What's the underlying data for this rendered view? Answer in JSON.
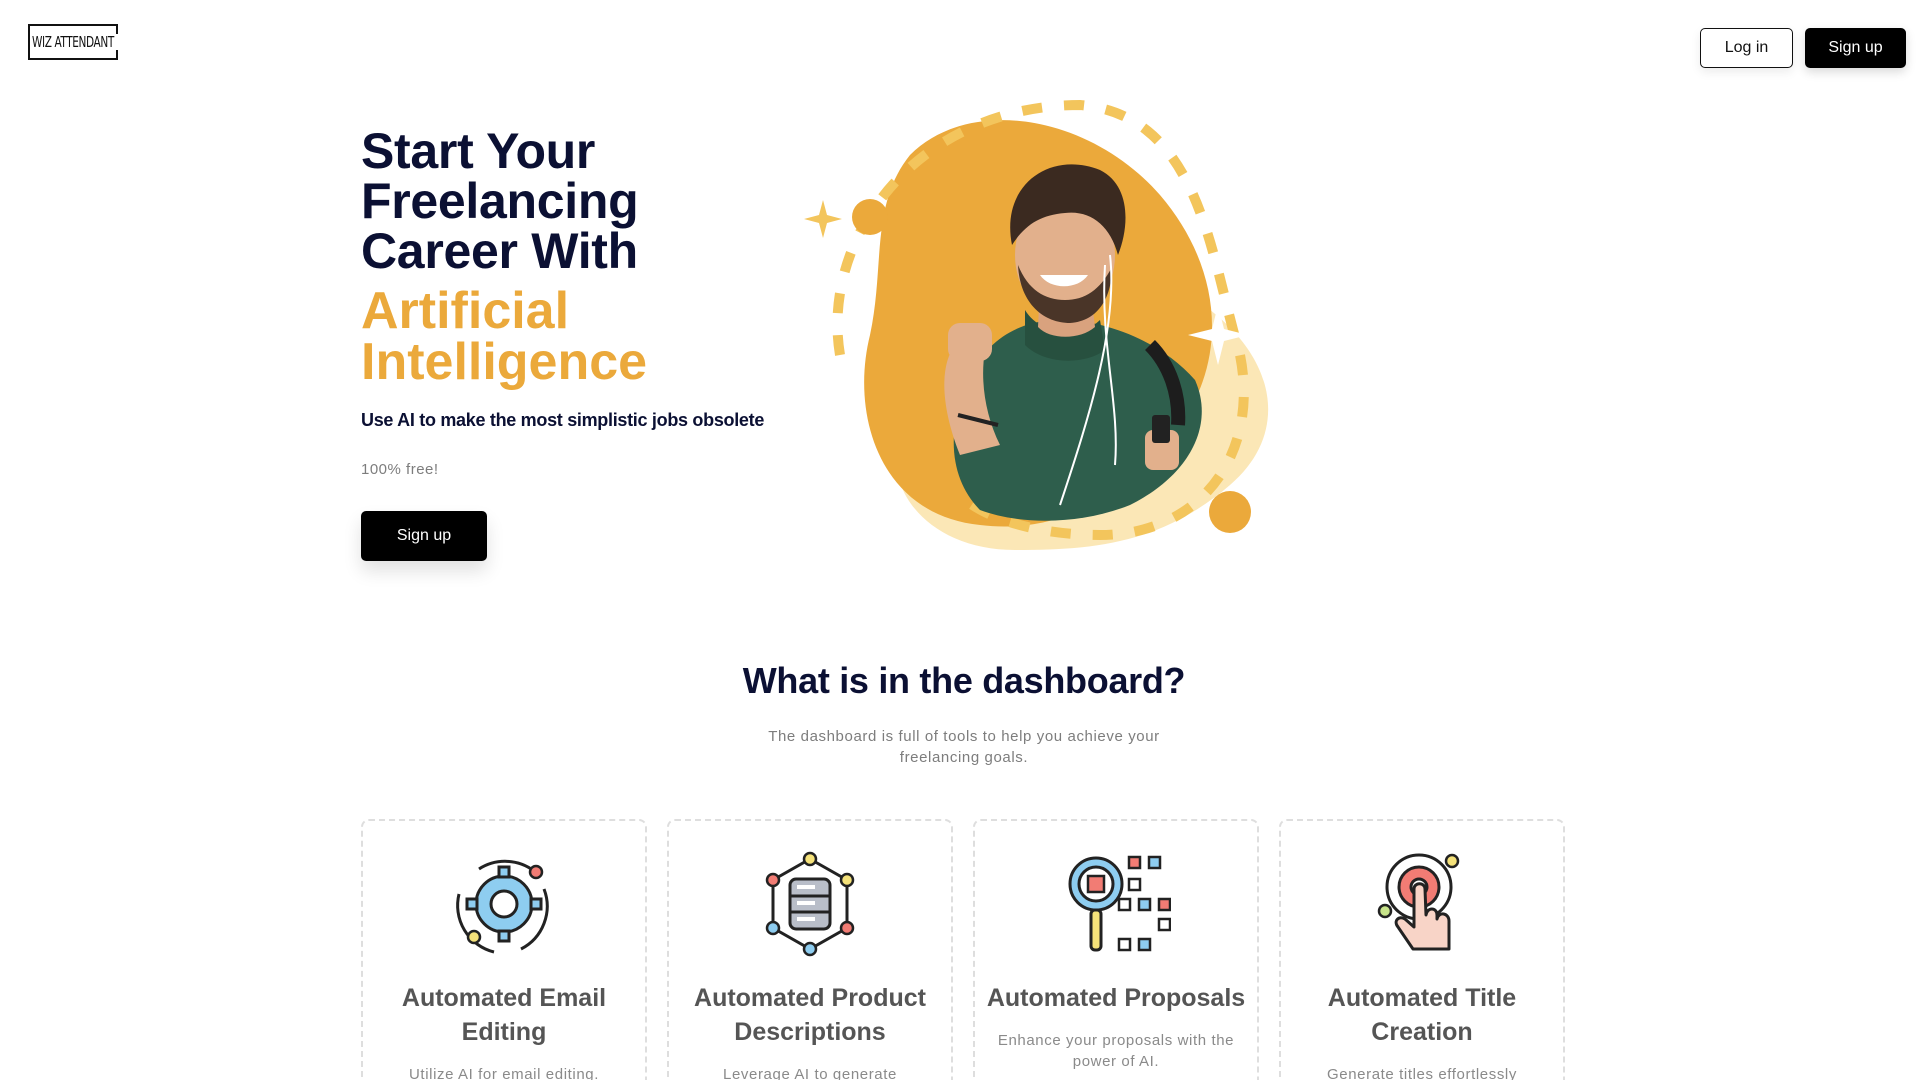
{
  "header": {
    "logo_text": "WIZ ATTENDANT",
    "login_label": "Log in",
    "signup_label": "Sign up"
  },
  "hero": {
    "title_lines": [
      "Start Your",
      "Freelancing",
      "Career With"
    ],
    "accent_lines": [
      "Artificial",
      "Intelligence"
    ],
    "subtitle": "Use AI to make the most simplistic jobs obsolete",
    "free_note": "100% free!",
    "cta_label": "Sign up",
    "illustration": "smiling-man-with-earphones-illustration"
  },
  "section": {
    "title": "What is in the dashboard?",
    "description": "The dashboard is full of tools to help you achieve your freelancing goals."
  },
  "cards": [
    {
      "icon": "gear-cycle-icon",
      "title": "Automated Email Editing",
      "description": "Utilize AI for email editing."
    },
    {
      "icon": "database-network-icon",
      "title": "Automated Product Descriptions",
      "description": "Leverage AI to generate"
    },
    {
      "icon": "magnifier-qr-icon",
      "title": "Automated Proposals",
      "description": "Enhance your proposals with the power of AI."
    },
    {
      "icon": "touch-target-icon",
      "title": "Automated Title Creation",
      "description": "Generate titles effortlessly"
    }
  ],
  "colors": {
    "navy": "#0b1033",
    "accent": "#eba93b",
    "accent_light": "#fbe7b6",
    "button": "#000000"
  }
}
